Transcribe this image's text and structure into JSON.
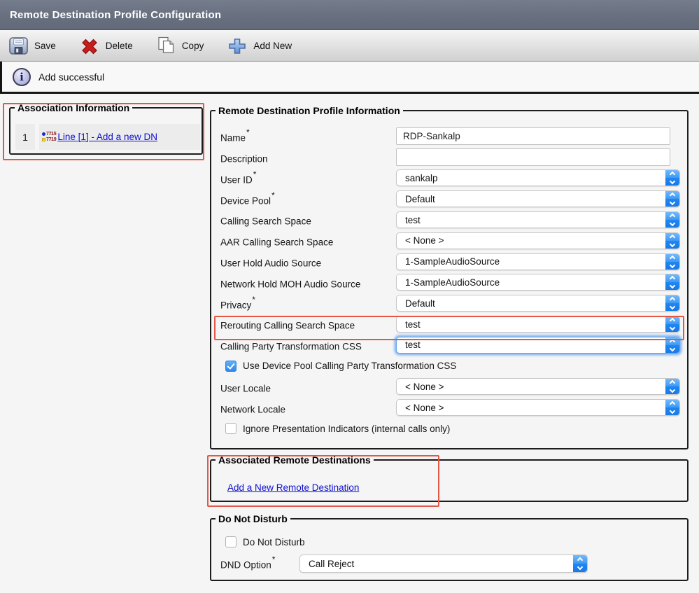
{
  "header": {
    "title": "Remote Destination Profile Configuration"
  },
  "toolbar": {
    "save_label": "Save",
    "delete_label": "Delete",
    "copy_label": "Copy",
    "add_new_label": "Add New"
  },
  "status": {
    "message": "Add successful"
  },
  "association": {
    "legend": "Association Information",
    "row_number": "1",
    "line_icon_top": "7715",
    "line_icon_bottom": "7719",
    "line_link": "Line [1] - Add a new DN"
  },
  "profile": {
    "legend": "Remote Destination Profile Information",
    "fields": [
      {
        "label": "Name",
        "req": "*",
        "value": "RDP-Sankalp"
      },
      {
        "label": "Description",
        "req": "",
        "value": ""
      },
      {
        "label": "User ID",
        "req": "*",
        "value": "sankalp"
      },
      {
        "label": "Device Pool",
        "req": "*",
        "value": "Default"
      },
      {
        "label": "Calling Search Space",
        "req": "",
        "value": "test"
      },
      {
        "label": "AAR Calling Search Space",
        "req": "",
        "value": "< None >"
      },
      {
        "label": "User Hold Audio Source",
        "req": "",
        "value": "1-SampleAudioSource"
      },
      {
        "label": "Network Hold MOH Audio Source",
        "req": "",
        "value": "1-SampleAudioSource"
      },
      {
        "label": "Privacy",
        "req": "*",
        "value": "Default"
      },
      {
        "label": "Rerouting Calling Search Space",
        "req": "",
        "value": "test"
      },
      {
        "label": "Calling Party Transformation CSS",
        "req": "",
        "value": "test"
      },
      {
        "label": "User Locale",
        "req": "",
        "value": "< None >"
      },
      {
        "label": "Network Locale",
        "req": "",
        "value": "< None >"
      }
    ],
    "checkbox_use_device_pool": {
      "label": "Use Device Pool Calling Party Transformation CSS",
      "checked": true
    },
    "checkbox_ignore_pi": {
      "label": "Ignore Presentation Indicators (internal calls only)",
      "checked": false
    }
  },
  "associated_destinations": {
    "legend": "Associated Remote Destinations",
    "link": "Add a New Remote Destination"
  },
  "dnd": {
    "legend": "Do Not Disturb",
    "checkbox_label": "Do Not Disturb",
    "checkbox_checked": false,
    "option_label": "DND Option",
    "option_req": "*",
    "option_value": "Call Reject"
  },
  "colors": {
    "header_slate": "#68707f",
    "annotation_red": "#e25746",
    "stepper_blue": "#2d89f0",
    "link_blue": "#0f0fd0"
  }
}
